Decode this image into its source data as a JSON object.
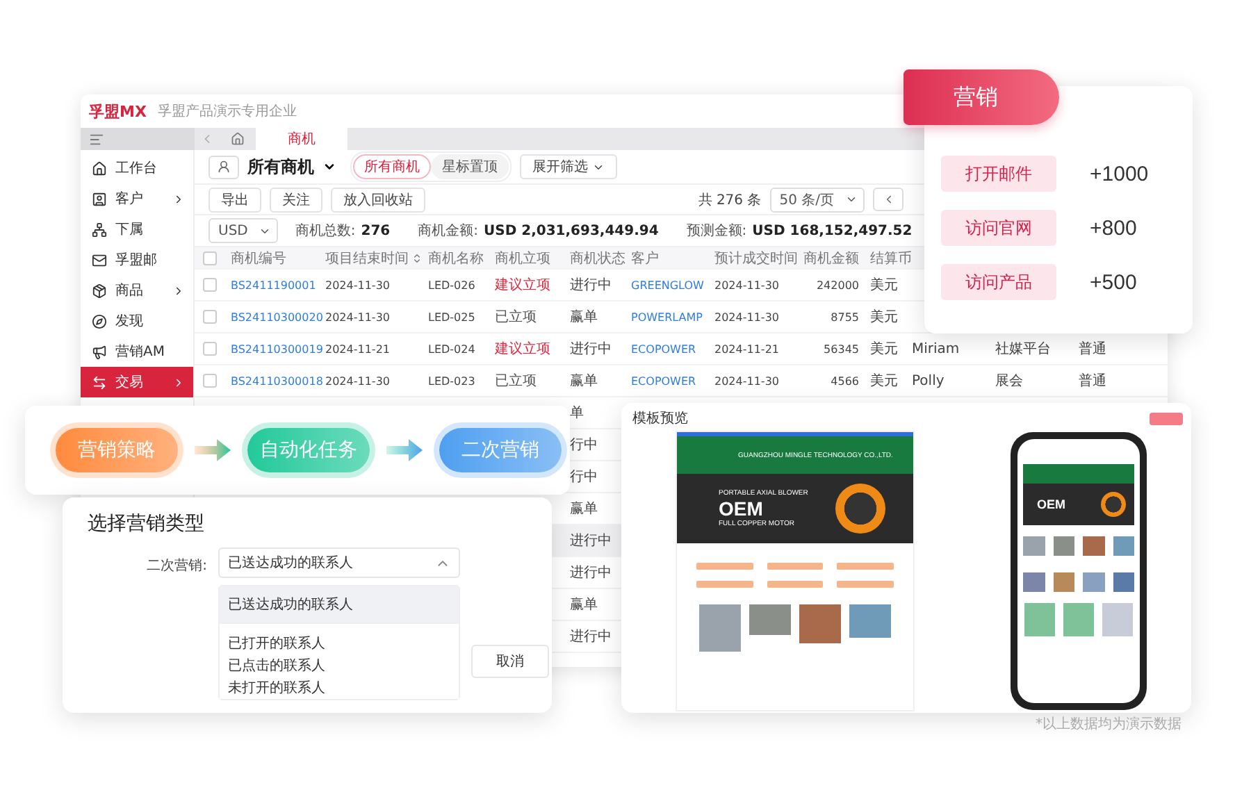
{
  "app": {
    "logo": "孚盟MX",
    "company": "孚盟产品演示专用企业"
  },
  "sidebar": {
    "items": [
      {
        "label": "工作台",
        "has_submenu": false,
        "selected": false
      },
      {
        "label": "客户",
        "has_submenu": true,
        "selected": false
      },
      {
        "label": "下属",
        "has_submenu": false,
        "selected": false
      },
      {
        "label": "孚盟邮",
        "has_submenu": false,
        "selected": false
      },
      {
        "label": "商品",
        "has_submenu": true,
        "selected": false
      },
      {
        "label": "发现",
        "has_submenu": false,
        "selected": false
      },
      {
        "label": "营销AM",
        "has_submenu": false,
        "selected": false
      },
      {
        "label": "交易",
        "has_submenu": true,
        "selected": true
      }
    ]
  },
  "tabs": [
    {
      "label": "商机",
      "selected": true
    }
  ],
  "toolbar": {
    "view_title": "所有商机",
    "segments": [
      {
        "label": "所有商机",
        "selected": true
      },
      {
        "label": "星标置顶",
        "selected": false
      }
    ],
    "filter_button": "展开筛选"
  },
  "actions": [
    "导出",
    "关注",
    "放入回收站"
  ],
  "pagination": {
    "total": "共 276 条",
    "page_size": "50 条/页"
  },
  "summary": {
    "currency": "USD",
    "stats": [
      {
        "label": "商机总数:",
        "value": "276"
      },
      {
        "label": "商机金额:",
        "value": "USD 2,031,693,449.94"
      },
      {
        "label": "预测金额:",
        "value": "USD 168,152,497.52"
      }
    ]
  },
  "table": {
    "all_checked": false,
    "columns": [
      {
        "label": "商机编号",
        "kind": "link",
        "sortable": false
      },
      {
        "label": "项目结束时间",
        "kind": "text",
        "sortable": true
      },
      {
        "label": "商机名称",
        "kind": "text",
        "sortable": false
      },
      {
        "label": "商机立项",
        "kind": "approval",
        "sortable": false
      },
      {
        "label": "商机状态",
        "kind": "text",
        "sortable": false
      },
      {
        "label": "客户",
        "kind": "link",
        "sortable": false
      },
      {
        "label": "预计成交时间",
        "kind": "text",
        "sortable": false
      },
      {
        "label": "商机金额",
        "kind": "number",
        "sortable": false
      },
      {
        "label": "结算币",
        "kind": "text",
        "sortable": false
      }
    ],
    "rows": [
      {
        "checked": false,
        "approval_pending": true,
        "cells": [
          "BS2411190001",
          "2024-11-30",
          "LED-026",
          "建议立项",
          "进行中",
          "GREENGLOW",
          "2024-11-30",
          "242000",
          "美元"
        ]
      },
      {
        "checked": false,
        "approval_pending": false,
        "cells": [
          "BS24110300020",
          "2024-11-30",
          "LED-025",
          "已立项",
          "赢单",
          "POWERLAMP",
          "2024-11-30",
          "8755",
          "美元"
        ]
      },
      {
        "checked": false,
        "approval_pending": true,
        "cells": [
          "BS24110300019",
          "2024-11-21",
          "LED-024",
          "建议立项",
          "进行中",
          "ECOPOWER",
          "2024-11-21",
          "56345",
          "美元",
          "Miriam",
          "社媒平台",
          "普通"
        ]
      },
      {
        "checked": false,
        "approval_pending": false,
        "cells": [
          "BS24110300018",
          "2024-11-30",
          "LED-023",
          "已立项",
          "赢单",
          "ECOPOWER",
          "2024-11-30",
          "4566",
          "美元",
          "Polly",
          "展会",
          "普通"
        ]
      }
    ],
    "more_rows": [
      {
        "status": "单",
        "hovered": false
      },
      {
        "status": "行中",
        "hovered": false
      },
      {
        "status": "行中",
        "hovered": false
      },
      {
        "status": "赢单",
        "hovered": false
      },
      {
        "status": "进行中",
        "hovered": true
      },
      {
        "status": "进行中",
        "hovered": false
      },
      {
        "status": "赢单",
        "hovered": false
      },
      {
        "status": "进行中",
        "hovered": false
      }
    ]
  },
  "marketing_card": {
    "title": "营销",
    "actions": [
      {
        "label": "打开邮件",
        "points": "+1000"
      },
      {
        "label": "访问官网",
        "points": "+800"
      },
      {
        "label": "访问产品",
        "points": "+500"
      }
    ]
  },
  "flow": {
    "steps": [
      {
        "label": "营销策略",
        "color": "#ff8a3d"
      },
      {
        "label": "自动化任务",
        "color": "#22c99a"
      },
      {
        "label": "二次营销",
        "color": "#4f9ff0"
      }
    ]
  },
  "dialog": {
    "title": "选择营销类型",
    "field_label": "二次营销:",
    "value": "已送达成功的联系人",
    "expanded": true,
    "options": [
      {
        "label": "已送达成功的联系人",
        "selected": true
      },
      {
        "label": "已打开的联系人",
        "selected": false
      },
      {
        "label": "已点击的联系人",
        "selected": false
      },
      {
        "label": "未打开的联系人",
        "selected": false
      }
    ],
    "cancel": "取消"
  },
  "preview": {
    "title": "模板预览",
    "site": {
      "company": "GUANGZHOU MINGLE TECHNOLOGY CO.,LTD.",
      "headline": "PORTABLE AXIAL BLOWER",
      "badge": "OEM",
      "tagline": "FULL COPPER MOTOR"
    },
    "phone": {
      "badge": "OEM"
    }
  },
  "footnote": "*以上数据均为演示数据"
}
